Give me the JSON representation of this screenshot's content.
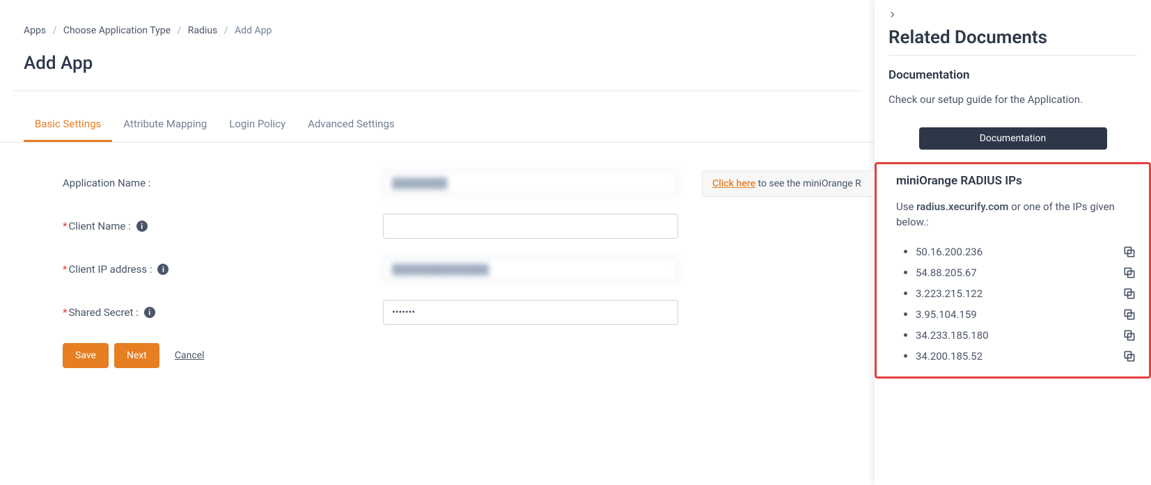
{
  "breadcrumb": {
    "items": [
      "Apps",
      "Choose Application Type",
      "Radius"
    ],
    "current": "Add App"
  },
  "page_title": "Add App",
  "tabs": [
    {
      "label": "Basic Settings",
      "active": true
    },
    {
      "label": "Attribute Mapping",
      "active": false
    },
    {
      "label": "Login Policy",
      "active": false
    },
    {
      "label": "Advanced Settings",
      "active": false
    }
  ],
  "form": {
    "app_name_label": "Application Name :",
    "app_name_value": "████████",
    "client_name_label": "Client Name :",
    "client_name_value": "",
    "client_ip_label": "Client IP address :",
    "client_ip_value": "██████████████",
    "shared_secret_label": "Shared Secret :",
    "shared_secret_value": "•••••••"
  },
  "notice": {
    "link_text": "Click here",
    "rest_text": " to see the miniOrange R"
  },
  "buttons": {
    "save": "Save",
    "next": "Next",
    "cancel": "Cancel"
  },
  "panel": {
    "title": "Related Documents",
    "doc_heading": "Documentation",
    "doc_text": "Check our setup guide for the Application.",
    "doc_button": "Documentation",
    "ips_title": "miniOrange RADIUS IPs",
    "ips_text_pre": "Use ",
    "ips_domain": "radius.xecurify.com",
    "ips_text_post": " or one of the IPs given below.:",
    "ips": [
      "50.16.200.236",
      "54.88.205.67",
      "3.223.215.122",
      "3.95.104.159",
      "34.233.185.180",
      "34.200.185.52"
    ]
  }
}
